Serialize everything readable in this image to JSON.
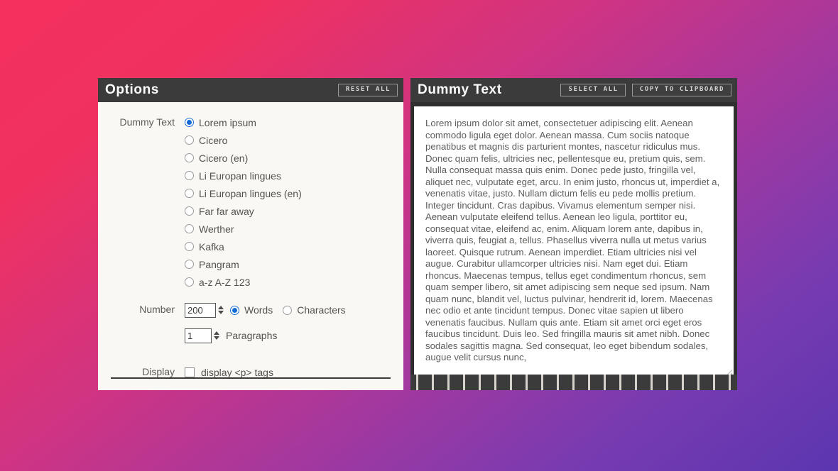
{
  "options_panel": {
    "title": "Options",
    "reset_button": "RESET ALL",
    "dummy_text_label": "Dummy Text",
    "number_label": "Number",
    "display_label": "Display",
    "text_sources": [
      {
        "label": "Lorem ipsum",
        "selected": true
      },
      {
        "label": "Cicero",
        "selected": false
      },
      {
        "label": "Cicero (en)",
        "selected": false
      },
      {
        "label": "Li Europan lingues",
        "selected": false
      },
      {
        "label": "Li Europan lingues (en)",
        "selected": false
      },
      {
        "label": "Far far away",
        "selected": false
      },
      {
        "label": "Werther",
        "selected": false
      },
      {
        "label": "Kafka",
        "selected": false
      },
      {
        "label": "Pangram",
        "selected": false
      },
      {
        "label": "a-z A-Z 123",
        "selected": false
      }
    ],
    "amount_value": "200",
    "unit_words_label": "Words",
    "unit_characters_label": "Characters",
    "unit_selected": "Words",
    "paragraphs_value": "1",
    "paragraphs_label": "Paragraphs",
    "display_p_tags_label": "display <p> tags",
    "display_p_tags_checked": false
  },
  "output_panel": {
    "title": "Dummy Text",
    "select_all_button": "SELECT ALL",
    "copy_button": "COPY TO CLIPBOARD",
    "body": "Lorem ipsum dolor sit amet, consectetuer adipiscing elit. Aenean commodo ligula eget dolor. Aenean massa. Cum sociis natoque penatibus et magnis dis parturient montes, nascetur ridiculus mus. Donec quam felis, ultricies nec, pellentesque eu, pretium quis, sem. Nulla consequat massa quis enim. Donec pede justo, fringilla vel, aliquet nec, vulputate eget, arcu. In enim justo, rhoncus ut, imperdiet a, venenatis vitae, justo. Nullam dictum felis eu pede mollis pretium. Integer tincidunt. Cras dapibus. Vivamus elementum semper nisi. Aenean vulputate eleifend tellus. Aenean leo ligula, porttitor eu, consequat vitae, eleifend ac, enim. Aliquam lorem ante, dapibus in, viverra quis, feugiat a, tellus. Phasellus viverra nulla ut metus varius laoreet. Quisque rutrum. Aenean imperdiet. Etiam ultricies nisi vel augue. Curabitur ullamcorper ultricies nisi. Nam eget dui. Etiam rhoncus. Maecenas tempus, tellus eget condimentum rhoncus, sem quam semper libero, sit amet adipiscing sem neque sed ipsum. Nam quam nunc, blandit vel, luctus pulvinar, hendrerit id, lorem. Maecenas nec odio et ante tincidunt tempus. Donec vitae sapien ut libero venenatis faucibus. Nullam quis ante. Etiam sit amet orci eget eros faucibus tincidunt. Duis leo. Sed fringilla mauris sit amet nibh. Donec sodales sagittis magna. Sed consequat, leo eget bibendum sodales, augue velit cursus nunc,"
  }
}
